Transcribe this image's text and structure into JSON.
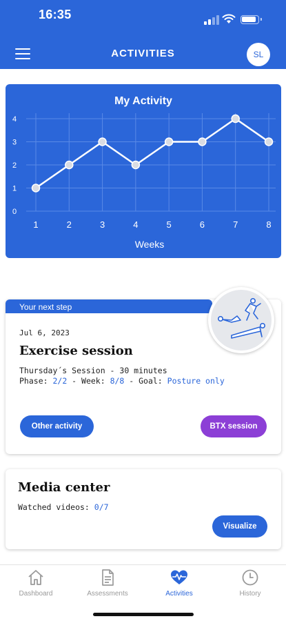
{
  "status_bar": {
    "time": "16:35"
  },
  "header": {
    "title": "ACTIVITIES",
    "avatar_initials": "SL"
  },
  "chart_data": {
    "type": "line",
    "title": "My Activity",
    "xlabel": "Weeks",
    "ylabel": "",
    "x": [
      1,
      2,
      3,
      4,
      5,
      6,
      7,
      8
    ],
    "values": [
      1,
      2,
      3,
      2,
      3,
      3,
      4,
      3
    ],
    "ylim": [
      0,
      4
    ],
    "yticks": [
      0,
      1,
      2,
      3,
      4
    ],
    "grid": true,
    "colors": {
      "background": "#2b66d9",
      "line": "#ffffff",
      "grid": "#5a8ae6"
    }
  },
  "next_step": {
    "ribbon": "Your next step",
    "date": "Jul 6, 2023",
    "title": "Exercise session",
    "session_line": "Thursday´s Session - 30 minutes",
    "phase_prefix": "Phase: ",
    "phase_value": "2/2",
    "week_prefix": " - Week: ",
    "week_value": "8/8",
    "goal_prefix": " - Goal: ",
    "goal_value": "Posture only",
    "other_button": "Other activity",
    "btx_button": "BTX session"
  },
  "media": {
    "title": "Media center",
    "watched_prefix": "Watched videos: ",
    "watched_value": "0/7",
    "visualize_button": "Visualize"
  },
  "nav": [
    {
      "label": "Dashboard",
      "icon": "home-icon"
    },
    {
      "label": "Assessments",
      "icon": "document-icon"
    },
    {
      "label": "Activities",
      "icon": "heartbeat-icon"
    },
    {
      "label": "History",
      "icon": "clock-icon"
    }
  ],
  "colors": {
    "primary": "#2b66d9",
    "accent_purple": "#8c3fd6",
    "inactive": "#9a9a9a"
  }
}
